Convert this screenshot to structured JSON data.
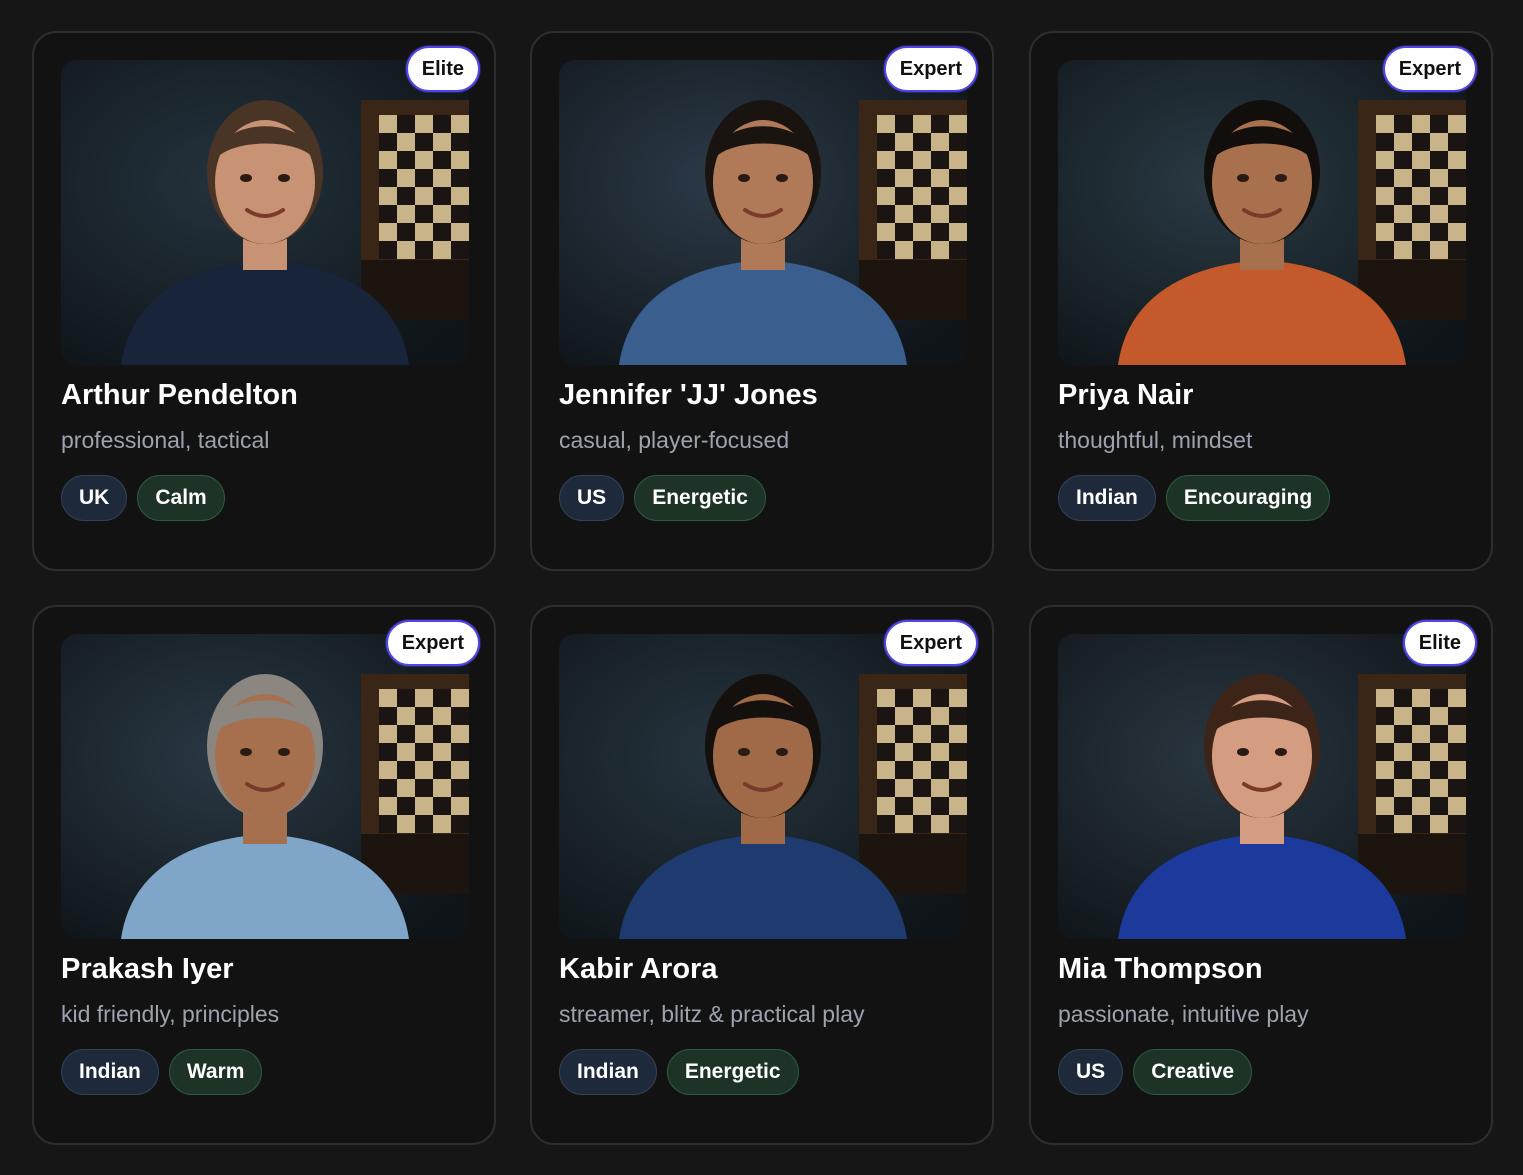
{
  "coaches": [
    {
      "name": "Arthur Pendelton",
      "description": "professional, tactical",
      "level": "Elite",
      "tags": [
        "UK",
        "Calm"
      ],
      "photo": {
        "icon": "coach-portrait",
        "skin": "#c89274",
        "hair": "#4a3426",
        "top": "#17243a",
        "bg": "#24323d"
      }
    },
    {
      "name": "Jennifer 'JJ' Jones",
      "description": "casual, player-focused",
      "level": "Expert",
      "tags": [
        "US",
        "Energetic"
      ],
      "photo": {
        "icon": "coach-portrait",
        "skin": "#b07a58",
        "hair": "#1a1410",
        "top": "#3a5f8e",
        "bg": "#2c3a48"
      }
    },
    {
      "name": "Priya Nair",
      "description": "thoughtful, mindset",
      "level": "Expert",
      "tags": [
        "Indian",
        "Encouraging"
      ],
      "photo": {
        "icon": "coach-portrait",
        "skin": "#a8704c",
        "hair": "#120e0c",
        "top": "#c45a2c",
        "bg": "#2a3a44"
      }
    },
    {
      "name": "Prakash Iyer",
      "description": "kid friendly, principles",
      "level": "Expert",
      "tags": [
        "Indian",
        "Warm"
      ],
      "photo": {
        "icon": "coach-portrait",
        "skin": "#a6704e",
        "hair": "#8c8680",
        "top": "#7fa6c8",
        "bg": "#2a3844"
      }
    },
    {
      "name": "Kabir Arora",
      "description": "streamer, blitz & practical play",
      "level": "Expert",
      "tags": [
        "Indian",
        "Energetic"
      ],
      "photo": {
        "icon": "coach-portrait",
        "skin": "#a06a48",
        "hair": "#14100e",
        "top": "#1e3a6e",
        "bg": "#26343e"
      }
    },
    {
      "name": "Mia Thompson",
      "description": "passionate, intuitive play",
      "level": "Elite",
      "tags": [
        "US",
        "Creative"
      ],
      "photo": {
        "icon": "coach-portrait",
        "skin": "#d49c80",
        "hair": "#3c2418",
        "top": "#1c3a9c",
        "bg": "#2a3640"
      }
    }
  ]
}
